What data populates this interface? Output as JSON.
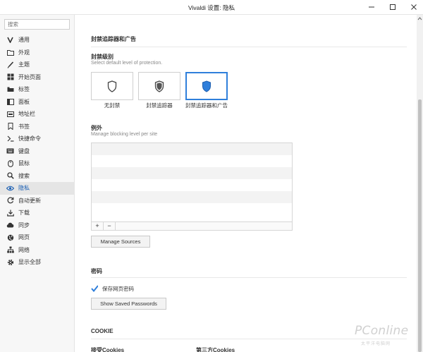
{
  "window": {
    "title": "Vivaldi 设置: 隐私"
  },
  "sidebar": {
    "search_placeholder": "搜索",
    "items": [
      {
        "label": "通用",
        "icon": "vivaldi-icon"
      },
      {
        "label": "外观",
        "icon": "folder-icon"
      },
      {
        "label": "主题",
        "icon": "brush-icon"
      },
      {
        "label": "开始页面",
        "icon": "grid-icon"
      },
      {
        "label": "标签",
        "icon": "tabs-icon"
      },
      {
        "label": "面板",
        "icon": "panel-icon"
      },
      {
        "label": "地址栏",
        "icon": "address-bar-icon"
      },
      {
        "label": "书签",
        "icon": "bookmark-icon"
      },
      {
        "label": "快捷命令",
        "icon": "quick-command-icon"
      },
      {
        "label": "键盘",
        "icon": "keyboard-icon"
      },
      {
        "label": "鼠标",
        "icon": "mouse-icon"
      },
      {
        "label": "搜索",
        "icon": "search-icon"
      },
      {
        "label": "隐私",
        "icon": "eye-icon",
        "active": true
      },
      {
        "label": "自动更新",
        "icon": "refresh-icon"
      },
      {
        "label": "下载",
        "icon": "download-icon"
      },
      {
        "label": "同步",
        "icon": "cloud-icon"
      },
      {
        "label": "网页",
        "icon": "globe-icon"
      },
      {
        "label": "网络",
        "icon": "network-icon"
      },
      {
        "label": "显示全部",
        "icon": "gear-icon"
      }
    ]
  },
  "tracker_section": {
    "title": "封禁追踪器和广告",
    "level_title": "封禁级别",
    "level_desc": "Select default level of protection.",
    "levels": [
      {
        "label": "无封禁",
        "icon": "shield-outline-icon",
        "selected": false
      },
      {
        "label": "封禁追踪器",
        "icon": "shield-half-icon",
        "selected": false
      },
      {
        "label": "封禁追踪器和广告",
        "icon": "shield-filled-icon",
        "selected": true
      }
    ],
    "exceptions_title": "例外",
    "exceptions_desc": "Manage blocking level per site",
    "add_label": "+",
    "remove_label": "−",
    "manage_sources_label": "Manage Sources"
  },
  "password_section": {
    "title": "密码",
    "save_passwords_label": "保存网页密码",
    "save_passwords_checked": true,
    "show_saved_label": "Show Saved Passwords"
  },
  "cookie_section": {
    "title": "COOKIE",
    "accept_label": "接受Cookies",
    "third_party_label": "第三方Cookies"
  },
  "watermark": {
    "brand": "PConline",
    "sub": "太平洋电脑网"
  },
  "colors": {
    "accent": "#2f7fdb",
    "active_item_text": "#1a5fb4"
  }
}
